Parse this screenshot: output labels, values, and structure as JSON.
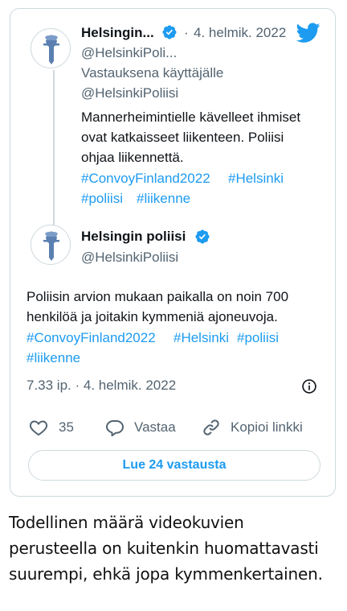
{
  "reply_tweet": {
    "display_name": "Helsingin...",
    "separator": "·",
    "date": "4. helmik. 2022",
    "handle": "@HelsinkiPoli...",
    "reply_label": "Vastauksena käyttäjälle",
    "reply_to": "@HelsinkiPoliisi",
    "text_lines": [
      "Mannerheimintielle kävelleet ihmiset",
      "ovat katkaisseet liikenteen. Poliisi",
      "ohjaa liikennettä."
    ],
    "hashtags_line1": [
      "#ConvoyFinland2022",
      "#Helsinki"
    ],
    "hashtags_line2": [
      "#poliisi",
      "#liikenne"
    ]
  },
  "main_tweet": {
    "display_name": "Helsingin poliisi",
    "handle": "@HelsinkiPoliisi",
    "text_lines": [
      "Poliisin arvion mukaan paikalla on noin 700",
      "henkilöä ja joitakin kymmeniä ajoneuvoja."
    ],
    "hashtags_line1": [
      "#ConvoyFinland2022",
      "#Helsinki",
      "#poliisi"
    ],
    "hashtags_line2": [
      "#liikenne"
    ],
    "timestamp": "7.33 ip. · 4. helmik. 2022",
    "like_count": "35",
    "reply_label": "Vastaa",
    "copy_link_label": "Kopioi linkki",
    "read_replies_label": "Lue 24 vastausta"
  },
  "caption_lines": [
    "Todellinen määrä videokuvien",
    "perusteella on kuitenkin huomattavasti",
    "suurempi, ehkä jopa kymmenkertainen."
  ],
  "colors": {
    "link": "#1d9bf0",
    "text": "#0f1419",
    "muted": "#536471",
    "border": "#cfd9de",
    "police_badge": "#5a7fb0"
  },
  "icons": [
    "police-badge-icon",
    "verified-icon",
    "twitter-bird-icon",
    "info-icon",
    "heart-icon",
    "reply-bubble-icon",
    "link-icon"
  ]
}
